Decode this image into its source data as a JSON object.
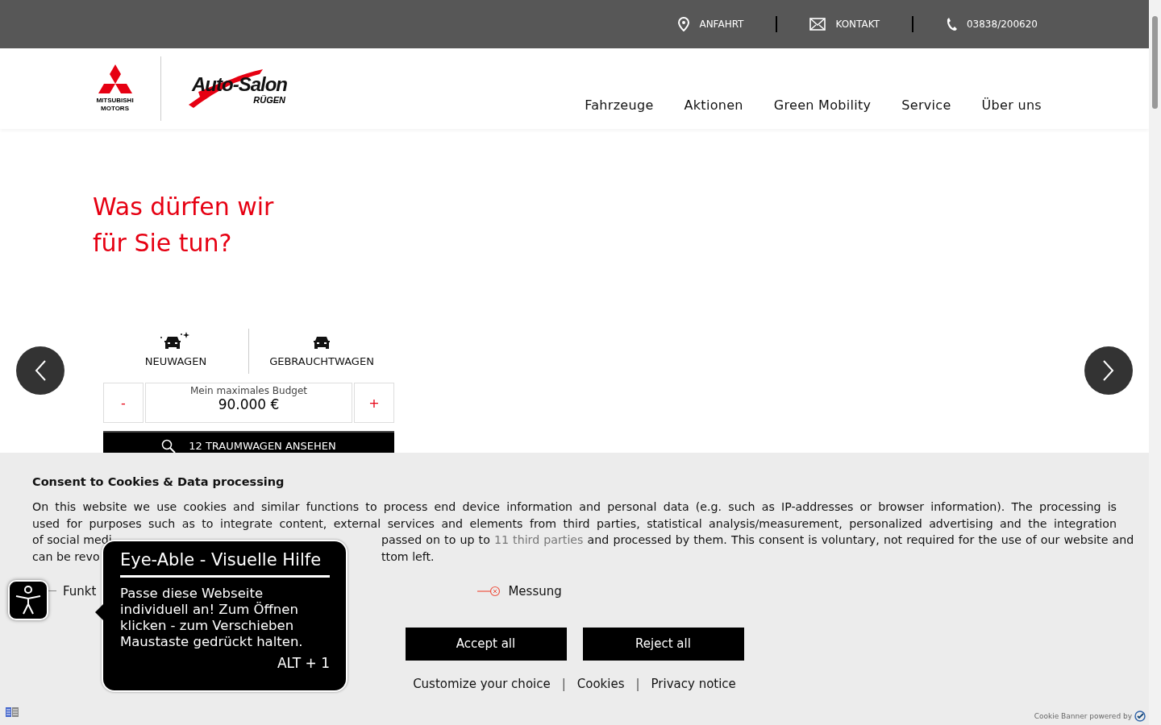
{
  "topbar": {
    "items": [
      {
        "kind": "pin",
        "label": "ANFAHRT"
      },
      {
        "kind": "mail",
        "label": "KONTAKT"
      },
      {
        "kind": "phone",
        "label": "03838/200620"
      }
    ]
  },
  "header": {
    "brand": {
      "line1": "MITSUBISHI",
      "line2": "MOTORS"
    },
    "dealer": {
      "name": "Auto-Salon",
      "sub": "RÜGEN"
    },
    "nav": [
      "Fahrzeuge",
      "Aktionen",
      "Green Mobility",
      "Service",
      "Über uns"
    ]
  },
  "hero": {
    "heading_lines": [
      "Was dürfen wir",
      "für Sie tun?"
    ],
    "tabs": [
      {
        "kind": "new",
        "label": "NEUWAGEN"
      },
      {
        "kind": "used",
        "label": "GEBRAUCHTWAGEN"
      }
    ],
    "budget": {
      "minus": "-",
      "label": "Mein maximales Budget",
      "value": "90.000 €",
      "plus": "+"
    },
    "search_button": "12 TRAUMWAGEN ANSEHEN"
  },
  "cookie_banner": {
    "title": "Consent to Cookies & Data processing",
    "lines": [
      {
        "left": "On this website we use cookies and similar functions to process end device information and personal data (e.g. such as IP-addresses or browser information). The processing is"
      },
      {
        "left": "used for purposes such as to integrate content, external services and elements from third parties, statistical analysis/measurement, personalized advertising and the integration"
      },
      {
        "left": "of social medi",
        "right": "passed on to up to",
        "link": "11 third parties",
        "right_after": "and processed by them. This consent is voluntary, not required for the use of our website and"
      },
      {
        "left": "can be revo",
        "right": "ttom left."
      }
    ],
    "toggles": [
      {
        "label": "Funkt"
      },
      {
        "label": "Messung",
        "checked": false
      }
    ],
    "buttons": [
      "Accept all",
      "Reject all"
    ],
    "links": [
      "Customize your choice",
      "Cookies",
      "Privacy notice"
    ],
    "separator": "|",
    "powered_by": "Cookie Banner powered by"
  },
  "accessibility_tooltip": {
    "title": "Eye-Able - Visuelle Hilfe",
    "text": "Passe diese Webseite individuell an! Zum Öffnen klicken - zum Verschieben Maustaste gedrückt halten.",
    "shortcut": "ALT + 1"
  }
}
